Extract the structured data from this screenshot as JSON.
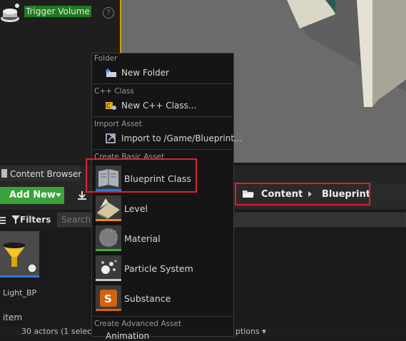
{
  "place_panel": {
    "trigger_volume_label": "Trigger Volume",
    "help_glyph": "?"
  },
  "content_browser": {
    "tab_label": "Content Browser",
    "add_new_label": "Add New",
    "import_partial": "I",
    "path": {
      "root": "Content",
      "folder": "Blueprint"
    },
    "filters_label": "Filters",
    "search_placeholder": "Search",
    "asset_name": "Light_BP",
    "item_count": "item",
    "status_left": "30 actors (1 selec",
    "status_right": "ptions ▾"
  },
  "menu": {
    "sections": {
      "folder": "Folder",
      "cpp": "C++ Class",
      "import": "Import Asset",
      "basic": "Create Basic Asset",
      "advanced": "Create Advanced Asset"
    },
    "items": {
      "new_folder": "New Folder",
      "new_cpp": "New C++ Class...",
      "import_to": "Import to /Game/Blueprint...",
      "blueprint_class": "Blueprint Class",
      "level": "Level",
      "material": "Material",
      "particle_system": "Particle System",
      "substance": "Substance",
      "animation_partial": "Animation"
    }
  },
  "colors": {
    "accent_green": "#3aa23a",
    "highlight_red": "#e0202a",
    "selection_blue": "#2b79d8",
    "viewport_border": "#c9a400"
  },
  "icons": [
    "trigger-volume-icon",
    "help-icon",
    "folder-icon",
    "new-folder-icon",
    "cpp-class-icon",
    "import-icon",
    "blueprint-class-icon",
    "level-icon",
    "material-icon",
    "particle-system-icon",
    "substance-icon",
    "filter-icon"
  ]
}
